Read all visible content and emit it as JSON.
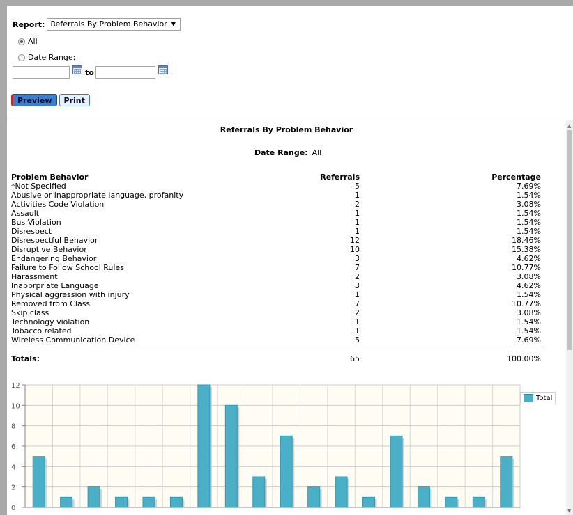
{
  "report": {
    "label": "Report:",
    "selected": "Referrals By Problem Behavior"
  },
  "filters": {
    "all_label": "All",
    "date_range_label": "Date Range:",
    "to_label": "to",
    "all_checked": true
  },
  "buttons": {
    "preview": "Preview",
    "print": "Print"
  },
  "report_body": {
    "title": "Referrals By Problem Behavior",
    "date_range_label": "Date Range:",
    "date_range_value": "All",
    "columns": [
      "Problem Behavior",
      "Referrals",
      "Percentage"
    ],
    "rows": [
      {
        "behavior": "*Not Specified",
        "referrals": "5",
        "percentage": "7.69%"
      },
      {
        "behavior": "Abusive or inappropriate language, profanity",
        "referrals": "1",
        "percentage": "1.54%"
      },
      {
        "behavior": "Activities Code Violation",
        "referrals": "2",
        "percentage": "3.08%"
      },
      {
        "behavior": "Assault",
        "referrals": "1",
        "percentage": "1.54%"
      },
      {
        "behavior": "Bus Violation",
        "referrals": "1",
        "percentage": "1.54%"
      },
      {
        "behavior": "Disrespect",
        "referrals": "1",
        "percentage": "1.54%"
      },
      {
        "behavior": "Disrespectful Behavior",
        "referrals": "12",
        "percentage": "18.46%"
      },
      {
        "behavior": "Disruptive Behavior",
        "referrals": "10",
        "percentage": "15.38%"
      },
      {
        "behavior": "Endangering Behavior",
        "referrals": "3",
        "percentage": "4.62%"
      },
      {
        "behavior": "Failure to Follow School Rules",
        "referrals": "7",
        "percentage": "10.77%"
      },
      {
        "behavior": "Harassment",
        "referrals": "2",
        "percentage": "3.08%"
      },
      {
        "behavior": "Inapprpriate Language",
        "referrals": "3",
        "percentage": "4.62%"
      },
      {
        "behavior": "Physical aggression with injury",
        "referrals": "1",
        "percentage": "1.54%"
      },
      {
        "behavior": "Removed from Class",
        "referrals": "7",
        "percentage": "10.77%"
      },
      {
        "behavior": "Skip class",
        "referrals": "2",
        "percentage": "3.08%"
      },
      {
        "behavior": "Technology violation",
        "referrals": "1",
        "percentage": "1.54%"
      },
      {
        "behavior": "Tobacco related",
        "referrals": "1",
        "percentage": "1.54%"
      },
      {
        "behavior": "Wireless Communication Device",
        "referrals": "5",
        "percentage": "7.69%"
      }
    ],
    "totals_label": "Totals:",
    "totals_referrals": "65",
    "totals_percentage": "100.00%"
  },
  "chart_data": {
    "type": "bar",
    "categories": [
      "*Not Specified",
      "Abusive or inappropriate language, profanity",
      "Activities Code Violation",
      "Assault",
      "Bus Violation",
      "Disrespect",
      "Disrespectful Behavior",
      "Disruptive Behavior",
      "Endangering Behavior",
      "Failure to Follow School Rules",
      "Harassment",
      "Inapprpriate Language",
      "Physical aggression with injury",
      "Removed from Class",
      "Skip class",
      "Technology violation",
      "Tobacco related",
      "Wireless Communication Device"
    ],
    "series": [
      {
        "name": "Total",
        "values": [
          5,
          1,
          2,
          1,
          1,
          1,
          12,
          10,
          3,
          7,
          2,
          3,
          1,
          7,
          2,
          1,
          1,
          5
        ]
      }
    ],
    "ylim": [
      0,
      12
    ],
    "yticks": [
      0,
      2,
      4,
      6,
      8,
      10,
      12
    ],
    "grid": true,
    "legend": "top-right",
    "bar_color": "#4ab0c8",
    "plot_background": "#fffdf3"
  },
  "colors": {
    "frame": "#a9a9a9",
    "preview_button": "#3b7ecf",
    "bar": "#4ab0c8"
  }
}
